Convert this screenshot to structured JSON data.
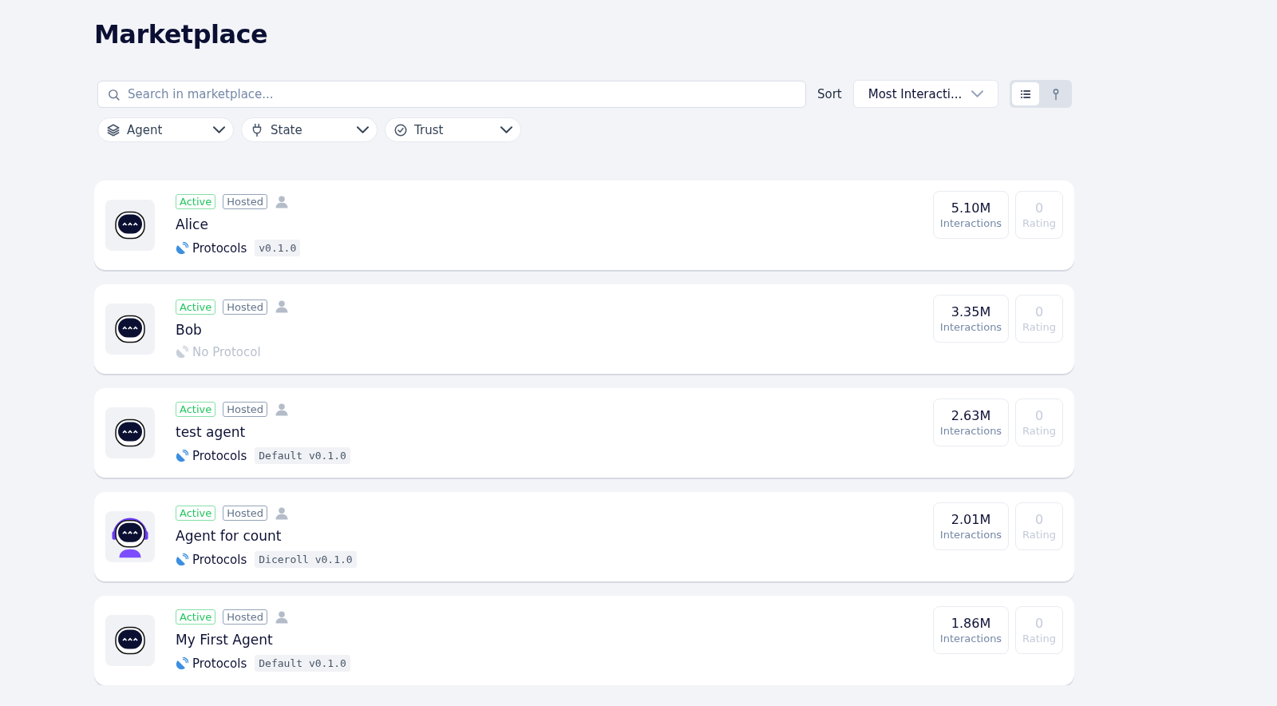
{
  "title": "Marketplace",
  "search": {
    "placeholder": "Search in marketplace..."
  },
  "sort": {
    "label": "Sort",
    "value": "Most Interacti..."
  },
  "view_toggle": [
    {
      "kind": "list",
      "selected": true
    },
    {
      "kind": "map",
      "selected": false
    }
  ],
  "filters": [
    {
      "kind": "layers",
      "label": "Agent"
    },
    {
      "kind": "plug",
      "label": "State"
    },
    {
      "kind": "badge",
      "label": "Trust"
    }
  ],
  "agents": [
    {
      "kind": "robot",
      "status": "Active",
      "hosting": "Hosted",
      "name": "Alice",
      "protocol": "Protocols",
      "protocol_disabled": false,
      "version": "v0.1.0",
      "interactions": "5.10M",
      "interactions_label": "Interactions",
      "rating": "0",
      "rating_label": "Rating"
    },
    {
      "kind": "robot",
      "status": "Active",
      "hosting": "Hosted",
      "name": "Bob",
      "protocol": "No Protocol",
      "protocol_disabled": true,
      "interactions": "3.35M",
      "interactions_label": "Interactions",
      "rating": "0",
      "rating_label": "Rating"
    },
    {
      "kind": "robot",
      "status": "Active",
      "hosting": "Hosted",
      "name": "test agent",
      "protocol": "Protocols",
      "protocol_disabled": false,
      "version": "Default v0.1.0",
      "interactions": "2.63M",
      "interactions_label": "Interactions",
      "rating": "0",
      "rating_label": "Rating"
    },
    {
      "kind": "robot-headset",
      "status": "Active",
      "hosting": "Hosted",
      "name": "Agent for count",
      "protocol": "Protocols",
      "protocol_disabled": false,
      "version": "Diceroll v0.1.0",
      "interactions": "2.01M",
      "interactions_label": "Interactions",
      "rating": "0",
      "rating_label": "Rating"
    },
    {
      "kind": "robot",
      "status": "Active",
      "hosting": "Hosted",
      "name": "My First Agent",
      "protocol": "Protocols",
      "protocol_disabled": false,
      "version": "Default v0.1.0",
      "interactions": "1.86M",
      "interactions_label": "Interactions",
      "rating": "0",
      "rating_label": "Rating"
    }
  ]
}
